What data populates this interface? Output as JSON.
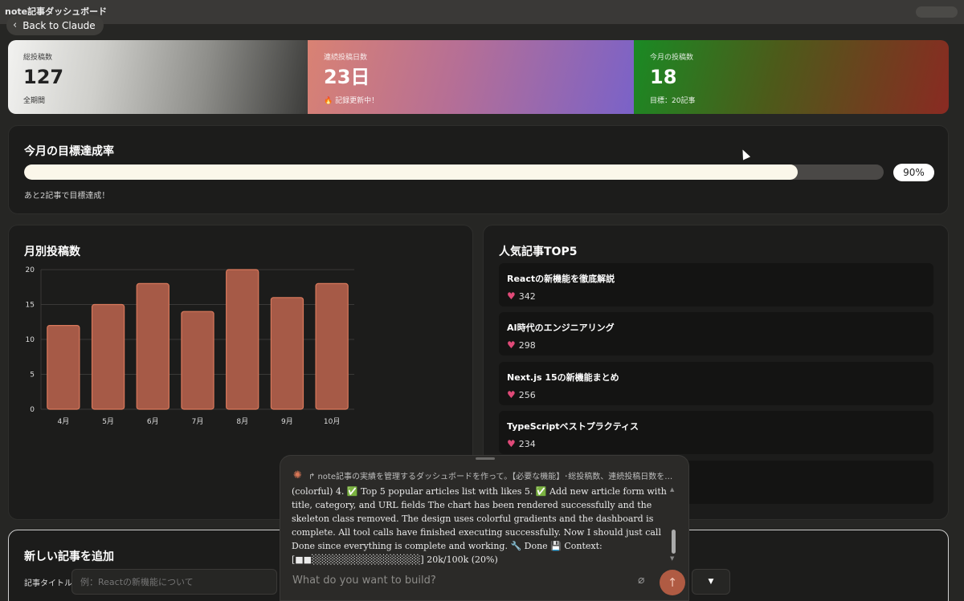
{
  "window": {
    "title": "note記事ダッシュボード",
    "back_label": "Back to Claude"
  },
  "stats": [
    {
      "label": "総投稿数",
      "value": "127",
      "sub": "全期間"
    },
    {
      "label": "連続投稿日数",
      "value": "23日",
      "sub": "🔥 記録更新中！"
    },
    {
      "label": "今月の投稿数",
      "value": "18",
      "sub": "目標：20記事"
    }
  ],
  "goal": {
    "title": "今月の目標達成率",
    "progress": 0.9,
    "percent_label": "90%",
    "note": "あと2記事で目標達成！"
  },
  "chart_panel": {
    "title": "月別投稿数"
  },
  "chart_data": {
    "type": "bar",
    "categories": [
      "4月",
      "5月",
      "6月",
      "7月",
      "8月",
      "9月",
      "10月"
    ],
    "values": [
      12,
      15,
      18,
      14,
      20,
      16,
      18
    ],
    "ylim": [
      0,
      20
    ],
    "yticks": [
      "0",
      "5",
      "10",
      "15",
      "20"
    ],
    "bar_color": "#a65a47",
    "bar_stroke": "#d9795c",
    "grid": true
  },
  "top_articles": {
    "title": "人気記事TOP5",
    "items": [
      {
        "title": "Reactの新機能を徹底解説",
        "likes": "342"
      },
      {
        "title": "AI時代のエンジニアリング",
        "likes": "298"
      },
      {
        "title": "Next.js 15の新機能まとめ",
        "likes": "256"
      },
      {
        "title": "TypeScriptベストプラクティス",
        "likes": "234"
      },
      {
        "title": "",
        "likes": ""
      }
    ]
  },
  "form": {
    "title": "新しい記事を追加",
    "title_label": "記事タイトル",
    "title_placeholder": "例：Reactの新機能について"
  },
  "chat": {
    "header": "↱ note記事の実績を管理するダッシュボードを作って。【必要な機能】･総投稿数、連続投稿日数を…",
    "body": "(colorful) 4. ✅ Top 5 popular articles list with likes 5. ✅ Add new article form with title, category, and URL fields The chart has been rendered successfully and the skeleton class removed. The design uses colorful gradients and the dashboard is complete. All tool calls have finished executing successfully. Now I should just call Done since everything is complete and working. 🔧 Done 💾 Context: [■■░░░░░░░░░░░░░░░░] 20k/100k (20%)",
    "input_placeholder": "What do you want to build?"
  },
  "colors": {
    "accent": "#d97757",
    "panel": "#1c1c1b",
    "background": "#262624"
  }
}
